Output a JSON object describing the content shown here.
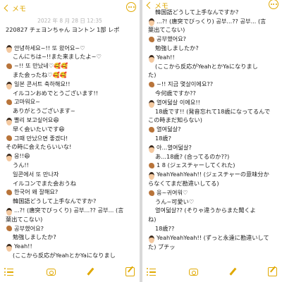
{
  "header": {
    "back_label": "メモ",
    "date": "2022 年 8 月 28 日 12:35"
  },
  "left": {
    "lines": [
      {
        "icon": "",
        "text": "220827 チェヨンちゃん ヨントン 1部 レポ",
        "indent": false
      },
      {
        "icon": "",
        "text": "",
        "indent": false
      },
      {
        "icon": "boy",
        "text": "안녕하세요~!! 또 왔어요~♡",
        "indent": false
      },
      {
        "icon": "",
        "text": "こんにちは~!!また来ましたよ~♡",
        "indent": true
      },
      {
        "icon": "squirrel",
        "text": "~!! 또 만났네♡🥰🥰",
        "indent": false
      },
      {
        "icon": "",
        "text": "また会ったね♡🥰🥰",
        "indent": true
      },
      {
        "icon": "boy",
        "text": "일본 콘서트 축하해요!!",
        "indent": false
      },
      {
        "icon": "",
        "text": "イルコンおめでとうございます!!",
        "indent": true
      },
      {
        "icon": "squirrel",
        "text": "고마워요~",
        "indent": false
      },
      {
        "icon": "",
        "text": "ありがとうございます~",
        "indent": true
      },
      {
        "icon": "boy",
        "text": "빨리 보고싶어요😆",
        "indent": false
      },
      {
        "icon": "",
        "text": "早く会いたいです😆",
        "indent": true
      },
      {
        "icon": "squirrel",
        "text": "그때 만났으면 좋겠다!",
        "indent": false
      },
      {
        "icon": "",
        "text": "その時に会えたらいいな!",
        "indent": false
      },
      {
        "icon": "boy",
        "text": "응!!😆",
        "indent": false
      },
      {
        "icon": "",
        "text": "うん!!",
        "indent": true
      },
      {
        "icon": "",
        "text": "일콘에서 또 만나자",
        "indent": true
      },
      {
        "icon": "",
        "text": "イルコンでまた会おうね",
        "indent": true
      },
      {
        "icon": "squirrel",
        "text": "한국어 왜 잘해요?",
        "indent": false
      },
      {
        "icon": "",
        "text": "韓国語どうして上手なんですか?",
        "indent": true
      },
      {
        "icon": "boy",
        "text": "...?! (唐突でびっくり) 공부...?? 공부... (言",
        "indent": false
      },
      {
        "icon": "",
        "text": "葉出てこない)",
        "indent": false
      },
      {
        "icon": "squirrel",
        "text": "공부했어요?",
        "indent": false
      },
      {
        "icon": "",
        "text": "勉強しましたか?",
        "indent": true
      },
      {
        "icon": "boy",
        "text": "Yeah!!",
        "indent": false
      },
      {
        "icon": "",
        "text": "(ここから反応がYeahとかYaになりまし",
        "indent": true
      }
    ]
  },
  "right": {
    "lines": [
      {
        "icon": "squirrel",
        "text": "한국어 왜 잘해요?",
        "indent": false
      },
      {
        "icon": "",
        "text": "韓国語どうして上手なんですか?",
        "indent": true
      },
      {
        "icon": "boy",
        "text": "...?! (唐突でびっくり) 공부...?? 공부... (言",
        "indent": false
      },
      {
        "icon": "",
        "text": "葉出てこない)",
        "indent": false
      },
      {
        "icon": "squirrel",
        "text": "공부했어요?",
        "indent": false
      },
      {
        "icon": "",
        "text": "勉強しましたか?",
        "indent": true
      },
      {
        "icon": "boy",
        "text": "Yeah!!",
        "indent": false
      },
      {
        "icon": "",
        "text": "(ここから反応がYeahとかYaになりまし",
        "indent": true
      },
      {
        "icon": "",
        "text": "た)",
        "indent": false
      },
      {
        "icon": "squirrel",
        "text": "~!! 지금 몇살이에요??",
        "indent": false
      },
      {
        "icon": "",
        "text": "今何歳ですか??",
        "indent": true
      },
      {
        "icon": "boy",
        "text": "열여덟살 이에요!!",
        "indent": false
      },
      {
        "icon": "",
        "text": "18歳です!! (発音忘れて18歳になってるんで",
        "indent": true
      },
      {
        "icon": "",
        "text": "この時まだ知らない)",
        "indent": false
      },
      {
        "icon": "squirrel",
        "text": "열여덟살?",
        "indent": false
      },
      {
        "icon": "",
        "text": "18歳?",
        "indent": true
      },
      {
        "icon": "boy",
        "text": "아...열여덟살?",
        "indent": false
      },
      {
        "icon": "",
        "text": "あ...18歳? (合ってるのか??)",
        "indent": true
      },
      {
        "icon": "squirrel",
        "text": "1 8 (ジェスチャーしてくれた)",
        "indent": false
      },
      {
        "icon": "boy",
        "text": "YeahYeahYeah!! (ジェスチャーの意味分か",
        "indent": false
      },
      {
        "icon": "",
        "text": "らなくてまだ勘違いしてる)",
        "indent": false
      },
      {
        "icon": "squirrel",
        "text": "웅~귀여워♡",
        "indent": false
      },
      {
        "icon": "",
        "text": "うん~可愛い♡",
        "indent": true
      },
      {
        "icon": "",
        "text": "열여덟살?? (そりゃ違うからまた聞くよ",
        "indent": true
      },
      {
        "icon": "",
        "text": "ね)",
        "indent": false
      },
      {
        "icon": "",
        "text": "18歳??",
        "indent": true
      },
      {
        "icon": "boy",
        "text": "YeahYeahYeah!! (ずっと永遠に勘違いして",
        "indent": false
      },
      {
        "icon": "",
        "text": "た) ブチッ",
        "indent": false
      }
    ]
  },
  "colors": {
    "accent": "#e0a800",
    "text": "#1c1c1c",
    "meta": "#b3b3b3"
  },
  "icons": {
    "back": "chevron-left-icon",
    "more": "ellipsis-circle-icon",
    "checklist": "checklist-icon",
    "camera": "camera-icon",
    "markup": "pen-icon",
    "compose": "compose-icon"
  }
}
